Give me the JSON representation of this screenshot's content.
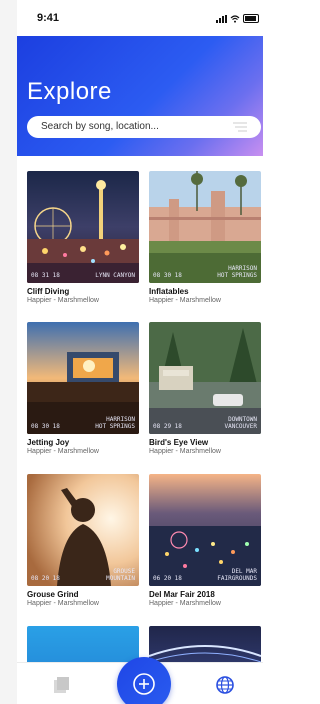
{
  "status_bar": {
    "time": "9:41"
  },
  "header": {
    "title": "Explore",
    "search_placeholder": "Search by song, location..."
  },
  "cards": [
    {
      "title": "Cliff Diving",
      "subtitle": "Happier - Marshmellow",
      "stamp_date": "08 31 18",
      "stamp_place": "LYNN CANYON"
    },
    {
      "title": "Inflatables",
      "subtitle": "Happier - Marshmellow",
      "stamp_date": "08 30 18",
      "stamp_place": "HARRISON\nHOT SPRINGS"
    },
    {
      "title": "Jetting Joy",
      "subtitle": "Happier - Marshmellow",
      "stamp_date": "08 30 18",
      "stamp_place": "HARRISON\nHOT SPRINGS"
    },
    {
      "title": "Bird's Eye View",
      "subtitle": "Happier - Marshmellow",
      "stamp_date": "08 29 18",
      "stamp_place": "DOWNTOWN\nVANCOUVER"
    },
    {
      "title": "Grouse Grind",
      "subtitle": "Happier - Marshmellow",
      "stamp_date": "08 20 18",
      "stamp_place": "GROUSE\nMOUNTAIN"
    },
    {
      "title": "Del Mar Fair 2018",
      "subtitle": "Happier - Marshmellow",
      "stamp_date": "06 20 18",
      "stamp_place": "DEL MAR\nFAIRGROUNDS"
    }
  ],
  "tabbar": {
    "items": [
      "library-icon",
      "add-icon",
      "globe-icon"
    ]
  }
}
